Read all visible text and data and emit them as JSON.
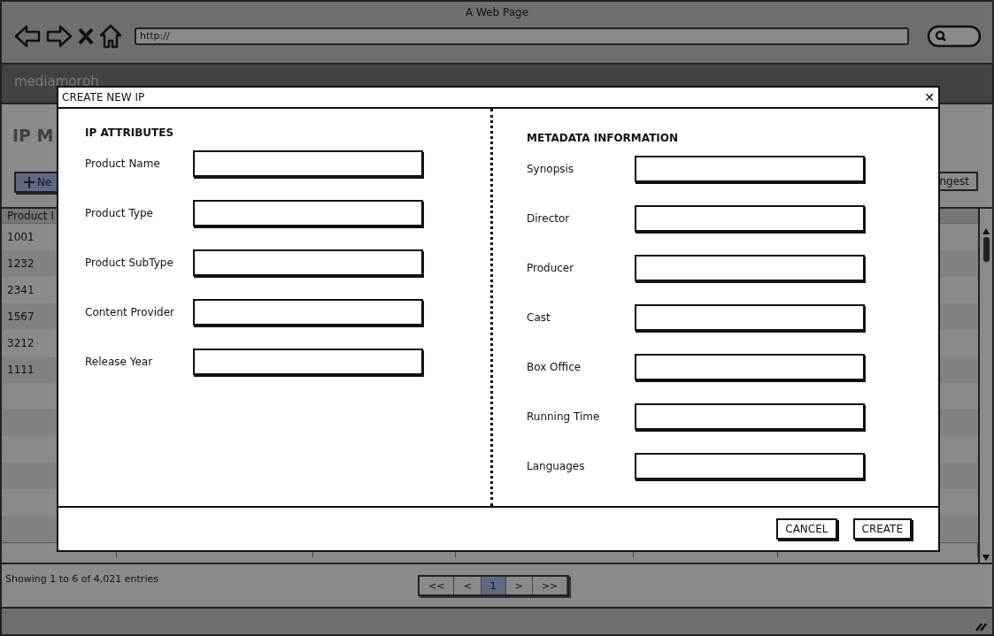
{
  "browser": {
    "title": "A Web Page",
    "url": "http://"
  },
  "app": {
    "brand": "mediamorph",
    "page_title": "IP M",
    "new_button": "Ne",
    "ingest_button": "ngest",
    "table": {
      "columns": [
        "Product I"
      ],
      "rows": [
        "1001",
        "1232",
        "2341",
        "1567",
        "3212",
        "1111"
      ]
    },
    "summary": "Showing 1 to 6 of 4,021 entries",
    "pagination": [
      {
        "label": "<<",
        "selected": false
      },
      {
        "label": "<",
        "selected": false
      },
      {
        "label": "1",
        "selected": true
      },
      {
        "label": ">",
        "selected": false
      },
      {
        "label": ">>",
        "selected": false
      }
    ]
  },
  "dialog": {
    "title": "CREATE NEW IP",
    "close": "✕",
    "sections": [
      {
        "heading": "IP ATTRIBUTES",
        "fields": [
          {
            "label": "Product Name"
          },
          {
            "label": "Product Type"
          },
          {
            "label": "Product SubType"
          },
          {
            "label": "Content Provider"
          },
          {
            "label": "Release Year"
          }
        ]
      },
      {
        "heading": "METADATA INFORMATION",
        "fields": [
          {
            "label": "Synopsis"
          },
          {
            "label": "Director"
          },
          {
            "label": "Producer"
          },
          {
            "label": "Cast"
          },
          {
            "label": "Box Office"
          },
          {
            "label": "Running Time"
          },
          {
            "label": "Languages"
          }
        ]
      }
    ],
    "buttons": [
      "CANCEL",
      "CREATE"
    ]
  }
}
